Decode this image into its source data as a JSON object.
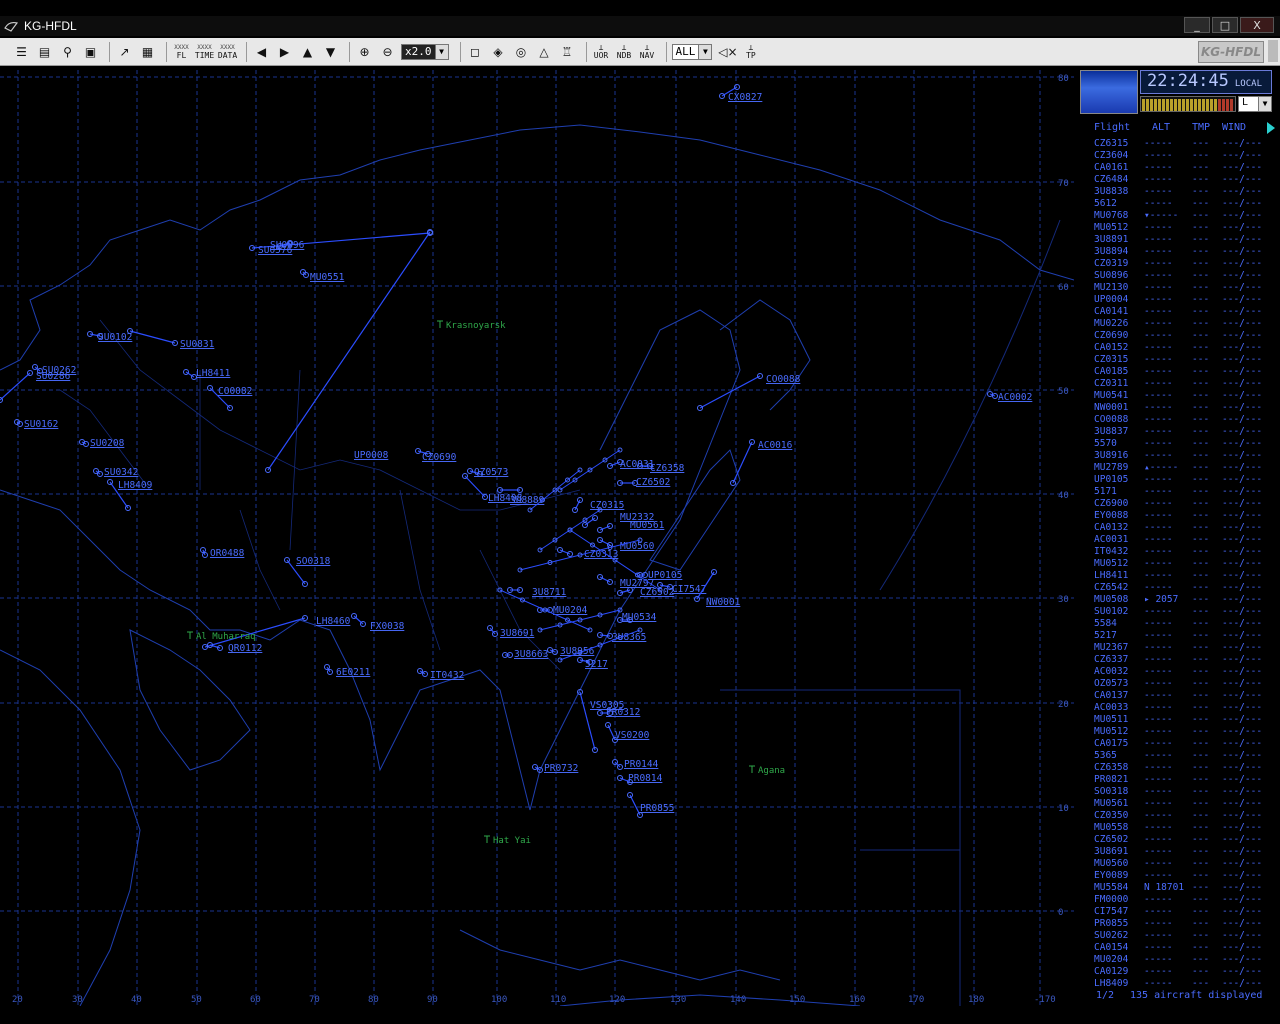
{
  "window": {
    "title": "KG-HFDL",
    "btn_min": "_",
    "btn_max": "□",
    "btn_close": "X"
  },
  "toolbar": {
    "fl_label": "FL",
    "time_label": "TIME",
    "data_label": "DATA",
    "zoom_value": "x2.0",
    "uor_label": "UOR",
    "ndb_label": "NDB",
    "nav_label": "NAV",
    "filter_value": "ALL",
    "tp_label": "TP",
    "brand": "KG-HFDL",
    "xxx": "XXXX"
  },
  "status": {
    "time": "22:24:45",
    "zone": "LOCAL",
    "level_select": "L"
  },
  "table": {
    "headers": {
      "flight": "Flight",
      "alt": "ALT",
      "tmp": "TMP",
      "wind": "WIND"
    },
    "rows": [
      {
        "flight": "CZ6315",
        "alt": "-----",
        "tmp": "---",
        "wind": "---/---"
      },
      {
        "flight": "CZ3604",
        "alt": "-----",
        "tmp": "---",
        "wind": "---/---"
      },
      {
        "flight": "CA0161",
        "alt": "-----",
        "tmp": "---",
        "wind": "---/---"
      },
      {
        "flight": "CZ6484",
        "alt": "-----",
        "tmp": "---",
        "wind": "---/---"
      },
      {
        "flight": "3U8838",
        "alt": "-----",
        "tmp": "---",
        "wind": "---/---"
      },
      {
        "flight": "5612",
        "alt": "-----",
        "tmp": "---",
        "wind": "---/---"
      },
      {
        "flight": "MU0768",
        "alt": "▾-----",
        "tmp": "---",
        "wind": "---/---"
      },
      {
        "flight": "MU0512",
        "alt": "-----",
        "tmp": "---",
        "wind": "---/---"
      },
      {
        "flight": "3U8891",
        "alt": "-----",
        "tmp": "---",
        "wind": "---/---"
      },
      {
        "flight": "3U8894",
        "alt": "-----",
        "tmp": "---",
        "wind": "---/---"
      },
      {
        "flight": "CZ0319",
        "alt": "-----",
        "tmp": "---",
        "wind": "---/---"
      },
      {
        "flight": "SU0896",
        "alt": "-----",
        "tmp": "---",
        "wind": "---/---"
      },
      {
        "flight": "MU2130",
        "alt": "-----",
        "tmp": "---",
        "wind": "---/---"
      },
      {
        "flight": "UP0004",
        "alt": "-----",
        "tmp": "---",
        "wind": "---/---"
      },
      {
        "flight": "CA0141",
        "alt": "-----",
        "tmp": "---",
        "wind": "---/---"
      },
      {
        "flight": "MU0226",
        "alt": "-----",
        "tmp": "---",
        "wind": "---/---"
      },
      {
        "flight": "CZ0690",
        "alt": "-----",
        "tmp": "---",
        "wind": "---/---"
      },
      {
        "flight": "CA0152",
        "alt": "-----",
        "tmp": "---",
        "wind": "---/---"
      },
      {
        "flight": "CZ0315",
        "alt": "-----",
        "tmp": "---",
        "wind": "---/---"
      },
      {
        "flight": "CA0185",
        "alt": "-----",
        "tmp": "---",
        "wind": "---/---"
      },
      {
        "flight": "CZ0311",
        "alt": "-----",
        "tmp": "---",
        "wind": "---/---"
      },
      {
        "flight": "MU0541",
        "alt": "-----",
        "tmp": "---",
        "wind": "---/---"
      },
      {
        "flight": "NW0001",
        "alt": "-----",
        "tmp": "---",
        "wind": "---/---"
      },
      {
        "flight": "CO0088",
        "alt": "-----",
        "tmp": "---",
        "wind": "---/---"
      },
      {
        "flight": "3U8837",
        "alt": "-----",
        "tmp": "---",
        "wind": "---/---"
      },
      {
        "flight": "5570",
        "alt": "-----",
        "tmp": "---",
        "wind": "---/---"
      },
      {
        "flight": "3U8916",
        "alt": "-----",
        "tmp": "---",
        "wind": "---/---"
      },
      {
        "flight": "MU2789",
        "alt": "▴-----",
        "tmp": "---",
        "wind": "---/---"
      },
      {
        "flight": "UP0105",
        "alt": "-----",
        "tmp": "---",
        "wind": "---/---"
      },
      {
        "flight": "5171",
        "alt": "-----",
        "tmp": "---",
        "wind": "---/---"
      },
      {
        "flight": "CZ6900",
        "alt": "-----",
        "tmp": "---",
        "wind": "---/---"
      },
      {
        "flight": "EY0088",
        "alt": "-----",
        "tmp": "---",
        "wind": "---/---"
      },
      {
        "flight": "CA0132",
        "alt": "-----",
        "tmp": "---",
        "wind": "---/---"
      },
      {
        "flight": "AC0031",
        "alt": "-----",
        "tmp": "---",
        "wind": "---/---"
      },
      {
        "flight": "IT0432",
        "alt": "-----",
        "tmp": "---",
        "wind": "---/---"
      },
      {
        "flight": "MU0512",
        "alt": "-----",
        "tmp": "---",
        "wind": "---/---"
      },
      {
        "flight": "LH8411",
        "alt": "-----",
        "tmp": "---",
        "wind": "---/---"
      },
      {
        "flight": "CZ6542",
        "alt": "-----",
        "tmp": "---",
        "wind": "---/---"
      },
      {
        "flight": "MU0508",
        "alt": "▸ 2057",
        "tmp": "---",
        "wind": "---/---"
      },
      {
        "flight": "SU0102",
        "alt": "-----",
        "tmp": "---",
        "wind": "---/---"
      },
      {
        "flight": "5584",
        "alt": "-----",
        "tmp": "---",
        "wind": "---/---"
      },
      {
        "flight": "5217",
        "alt": "-----",
        "tmp": "---",
        "wind": "---/---"
      },
      {
        "flight": "MU2367",
        "alt": "-----",
        "tmp": "---",
        "wind": "---/---"
      },
      {
        "flight": "CZ6337",
        "alt": "-----",
        "tmp": "---",
        "wind": "---/---"
      },
      {
        "flight": "AC0032",
        "alt": "-----",
        "tmp": "---",
        "wind": "---/---"
      },
      {
        "flight": "OZ0573",
        "alt": "-----",
        "tmp": "---",
        "wind": "---/---"
      },
      {
        "flight": "CA0137",
        "alt": "-----",
        "tmp": "---",
        "wind": "---/---"
      },
      {
        "flight": "AC0033",
        "alt": "-----",
        "tmp": "---",
        "wind": "---/---"
      },
      {
        "flight": "MU0511",
        "alt": "-----",
        "tmp": "---",
        "wind": "---/---"
      },
      {
        "flight": "MU0512",
        "alt": "-----",
        "tmp": "---",
        "wind": "---/---"
      },
      {
        "flight": "CA0175",
        "alt": "-----",
        "tmp": "---",
        "wind": "---/---"
      },
      {
        "flight": "5365",
        "alt": "-----",
        "tmp": "---",
        "wind": "---/---"
      },
      {
        "flight": "CZ6358",
        "alt": "-----",
        "tmp": "---",
        "wind": "---/---"
      },
      {
        "flight": "PR0821",
        "alt": "-----",
        "tmp": "---",
        "wind": "---/---"
      },
      {
        "flight": "SO0318",
        "alt": "-----",
        "tmp": "---",
        "wind": "---/---"
      },
      {
        "flight": "MU0561",
        "alt": "-----",
        "tmp": "---",
        "wind": "---/---"
      },
      {
        "flight": "CZ0350",
        "alt": "-----",
        "tmp": "---",
        "wind": "---/---"
      },
      {
        "flight": "MU0558",
        "alt": "-----",
        "tmp": "---",
        "wind": "---/---"
      },
      {
        "flight": "CZ6502",
        "alt": "-----",
        "tmp": "---",
        "wind": "---/---"
      },
      {
        "flight": "3U8691",
        "alt": "-----",
        "tmp": "---",
        "wind": "---/---"
      },
      {
        "flight": "MU0560",
        "alt": "-----",
        "tmp": "---",
        "wind": "---/---"
      },
      {
        "flight": "EY0089",
        "alt": "-----",
        "tmp": "---",
        "wind": "---/---"
      },
      {
        "flight": "MU5584",
        "alt": "N 18701",
        "tmp": "---",
        "wind": "---/---"
      },
      {
        "flight": "FM0000",
        "alt": "-----",
        "tmp": "---",
        "wind": "---/---"
      },
      {
        "flight": "CI7547",
        "alt": "-----",
        "tmp": "---",
        "wind": "---/---"
      },
      {
        "flight": "PR0855",
        "alt": "-----",
        "tmp": "---",
        "wind": "---/---"
      },
      {
        "flight": "SU0262",
        "alt": "-----",
        "tmp": "---",
        "wind": "---/---"
      },
      {
        "flight": "CA0154",
        "alt": "-----",
        "tmp": "---",
        "wind": "---/---"
      },
      {
        "flight": "MU0204",
        "alt": "-----",
        "tmp": "---",
        "wind": "---/---"
      },
      {
        "flight": "CA0129",
        "alt": "-----",
        "tmp": "---",
        "wind": "---/---"
      },
      {
        "flight": "LH8409",
        "alt": "-----",
        "tmp": "---",
        "wind": "---/---"
      }
    ],
    "page": "1/2",
    "count_text": "135 aircraft displayed"
  },
  "map": {
    "lat_labels": [
      "80",
      "70",
      "60",
      "50",
      "40",
      "30",
      "20",
      "10",
      "0"
    ],
    "lon_labels": [
      "20",
      "30",
      "40",
      "50",
      "60",
      "70",
      "80",
      "90",
      "100",
      "110",
      "120",
      "130",
      "140",
      "150",
      "160",
      "170",
      "180",
      "-170"
    ],
    "cities": [
      "Krasnoyarsk",
      "Al Muharraq",
      "Agana",
      "Hat Yai"
    ],
    "flights": [
      "CX0827",
      "SU0576",
      "SU0896",
      "MU0551",
      "SU0102",
      "SU0831",
      "SU0262",
      "SU0286",
      "LH8411",
      "CO0082",
      "SU0162",
      "SU0208",
      "SU0342",
      "LH8409",
      "UP0008",
      "CZ0690",
      "OZ0573",
      "LH8408",
      "3U8889",
      "AC0031",
      "CZ6358",
      "CZ6502",
      "AC0002",
      "CO0088",
      "AC0016",
      "CZ0315",
      "MU2332",
      "MU0561",
      "MU0560",
      "CZ0313",
      "3U8711",
      "MU2797",
      "CZ6502",
      "UP0105",
      "CI7547",
      "NW0001",
      "MU0204",
      "MU0534",
      "3U8691",
      "3U8663",
      "3U8956",
      "3U8365",
      "5217",
      "VS0305",
      "PR0312",
      "VS0200",
      "PR0144",
      "PR0814",
      "PR0855",
      "PR0732",
      "OR0488",
      "SO0318",
      "LH8460",
      "FX0038",
      "QR0112",
      "6E0211",
      "IT0432"
    ]
  }
}
